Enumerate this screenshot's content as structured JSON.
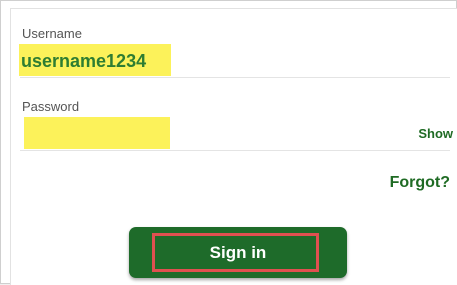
{
  "form": {
    "username_label": "Username",
    "username_value": "username1234",
    "password_label": "Password",
    "password_value": "",
    "show_label": "Show",
    "forgot_label": "Forgot?",
    "signin_label": "Sign in"
  },
  "colors": {
    "highlight": "#fcf25a",
    "button_bg": "#1e6b2a",
    "link": "#1f6b24",
    "annotation_box": "#e05050"
  }
}
